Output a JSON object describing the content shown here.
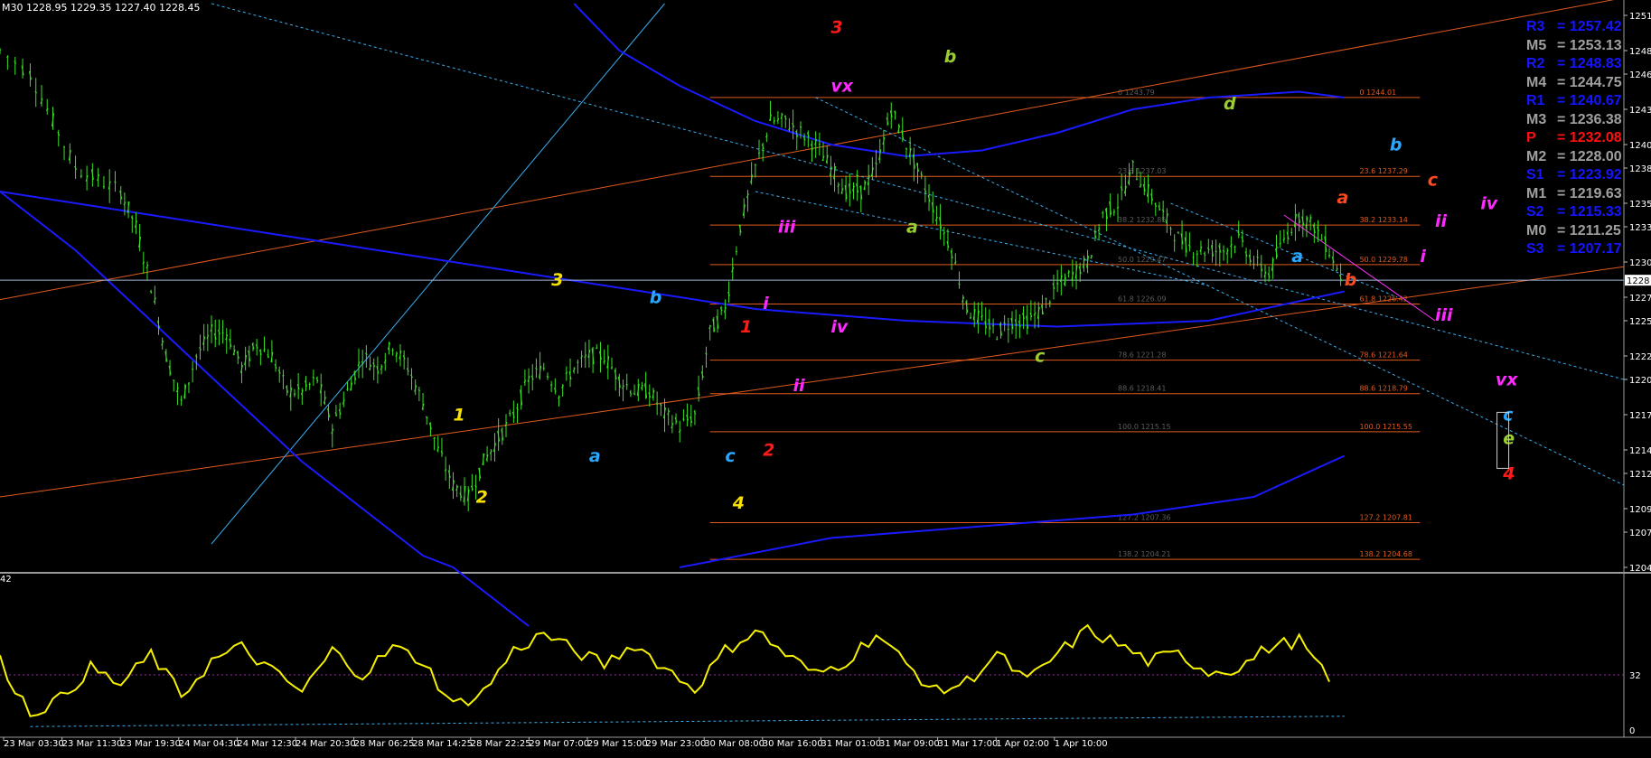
{
  "header": {
    "timeframe": "M30",
    "ohlc": "1228.95 1229.35 1227.40 1228.45"
  },
  "sub_window": {
    "label": "42"
  },
  "pivots": [
    {
      "name": "R3",
      "value": "1257.42",
      "color": "#1515ff"
    },
    {
      "name": "M5",
      "value": "1253.13",
      "color": "#a0a0a0"
    },
    {
      "name": "R2",
      "value": "1248.83",
      "color": "#1515ff"
    },
    {
      "name": "M4",
      "value": "1244.75",
      "color": "#a0a0a0"
    },
    {
      "name": "R1",
      "value": "1240.67",
      "color": "#1515ff"
    },
    {
      "name": "M3",
      "value": "1236.38",
      "color": "#a0a0a0"
    },
    {
      "name": "P",
      "value": "1232.08",
      "color": "#ff1010"
    },
    {
      "name": "M2",
      "value": "1228.00",
      "color": "#a0a0a0"
    },
    {
      "name": "S1",
      "value": "1223.92",
      "color": "#1515ff"
    },
    {
      "name": "M1",
      "value": "1219.63",
      "color": "#a0a0a0"
    },
    {
      "name": "S2",
      "value": "1215.33",
      "color": "#1515ff"
    },
    {
      "name": "M0",
      "value": "1211.25",
      "color": "#a0a0a0"
    },
    {
      "name": "S3",
      "value": "1207.17",
      "color": "#1515ff"
    }
  ],
  "colors": {
    "background": "#000000",
    "candles": "#3ce028",
    "moving_average": "#1a1aff",
    "fib_lines": "#e05a1e",
    "trend_lines": "#e05a1e",
    "channel": "#3aaef0",
    "oscillator": "#f5f000",
    "price_line": "#a0b8d8"
  },
  "chart_data": {
    "type": "line",
    "symbol_timeframe": "M30",
    "current_price": 1228.45,
    "y_range": [
      1204,
      1252
    ],
    "y_ticks": [
      1251,
      1248,
      1246,
      1243,
      1240,
      1238,
      1235,
      1233,
      1230,
      1227,
      1225,
      1222,
      1220,
      1217,
      1214,
      1212,
      1209,
      1207,
      1204
    ],
    "price_marker": "1228",
    "x_tick_labels": [
      "23 Mar 03:30",
      "23 Mar 11:30",
      "23 Mar 19:30",
      "24 Mar 04:30",
      "24 Mar 12:30",
      "24 Mar 20:30",
      "28 Mar 06:25",
      "28 Mar 14:25",
      "28 Mar 22:25",
      "29 Mar 07:00",
      "29 Mar 15:00",
      "29 Mar 23:00",
      "30 Mar 08:00",
      "30 Mar 16:00",
      "31 Mar 01:00",
      "31 Mar 09:00",
      "31 Mar 17:00",
      "1 Apr 02:00",
      "1 Apr 10:00"
    ],
    "price_series": [
      [
        0,
        1248
      ],
      [
        4,
        1246
      ],
      [
        7,
        1242
      ],
      [
        10,
        1238
      ],
      [
        13,
        1237
      ],
      [
        16,
        1236
      ],
      [
        18,
        1233
      ],
      [
        20,
        1228
      ],
      [
        22,
        1222
      ],
      [
        24,
        1218
      ],
      [
        26,
        1222
      ],
      [
        28,
        1224
      ],
      [
        30,
        1224
      ],
      [
        32,
        1221
      ],
      [
        34,
        1223
      ],
      [
        36,
        1222
      ],
      [
        38,
        1219
      ],
      [
        40,
        1219
      ],
      [
        42,
        1220
      ],
      [
        44,
        1216
      ],
      [
        46,
        1219
      ],
      [
        48,
        1222
      ],
      [
        50,
        1221
      ],
      [
        52,
        1223
      ],
      [
        54,
        1221
      ],
      [
        56,
        1218
      ],
      [
        58,
        1214
      ],
      [
        60,
        1211
      ],
      [
        62,
        1210
      ],
      [
        64,
        1213
      ],
      [
        66,
        1215
      ],
      [
        68,
        1217
      ],
      [
        70,
        1220
      ],
      [
        72,
        1221
      ],
      [
        74,
        1219
      ],
      [
        76,
        1221
      ],
      [
        78,
        1222
      ],
      [
        80,
        1222
      ],
      [
        82,
        1220
      ],
      [
        84,
        1219
      ],
      [
        86,
        1219
      ],
      [
        88,
        1217
      ],
      [
        90,
        1216
      ],
      [
        92,
        1217
      ],
      [
        94,
        1224
      ],
      [
        96,
        1226
      ],
      [
        98,
        1233
      ],
      [
        100,
        1238
      ],
      [
        102,
        1242
      ],
      [
        104,
        1242
      ],
      [
        106,
        1241
      ],
      [
        108,
        1240
      ],
      [
        110,
        1238
      ],
      [
        112,
        1236
      ],
      [
        114,
        1236
      ],
      [
        116,
        1238
      ],
      [
        118,
        1243
      ],
      [
        120,
        1240
      ],
      [
        122,
        1237
      ],
      [
        124,
        1234
      ],
      [
        126,
        1231
      ],
      [
        128,
        1226
      ],
      [
        130,
        1225
      ],
      [
        132,
        1224
      ],
      [
        134,
        1225
      ],
      [
        136,
        1225
      ],
      [
        138,
        1226
      ],
      [
        140,
        1228
      ],
      [
        142,
        1229
      ],
      [
        144,
        1230
      ],
      [
        146,
        1234
      ],
      [
        148,
        1235
      ],
      [
        150,
        1238
      ],
      [
        152,
        1236
      ],
      [
        154,
        1234
      ],
      [
        156,
        1232
      ],
      [
        158,
        1231
      ],
      [
        160,
        1231
      ],
      [
        162,
        1231
      ],
      [
        164,
        1232
      ],
      [
        166,
        1230
      ],
      [
        168,
        1229
      ],
      [
        170,
        1232
      ],
      [
        172,
        1234
      ],
      [
        174,
        1233
      ],
      [
        176,
        1231
      ],
      [
        178,
        1228
      ]
    ],
    "oscillator": {
      "y_ticks": [
        32,
        0
      ],
      "dotted_level": 32,
      "values": [
        [
          0,
          40
        ],
        [
          4,
          10
        ],
        [
          8,
          18
        ],
        [
          12,
          36
        ],
        [
          16,
          26
        ],
        [
          20,
          44
        ],
        [
          24,
          20
        ],
        [
          28,
          40
        ],
        [
          32,
          48
        ],
        [
          36,
          34
        ],
        [
          40,
          22
        ],
        [
          44,
          46
        ],
        [
          48,
          32
        ],
        [
          52,
          48
        ],
        [
          56,
          40
        ],
        [
          60,
          14
        ],
        [
          64,
          22
        ],
        [
          68,
          46
        ],
        [
          72,
          56
        ],
        [
          76,
          46
        ],
        [
          80,
          38
        ],
        [
          84,
          50
        ],
        [
          88,
          36
        ],
        [
          92,
          24
        ],
        [
          96,
          46
        ],
        [
          100,
          58
        ],
        [
          104,
          44
        ],
        [
          108,
          32
        ],
        [
          112,
          40
        ],
        [
          116,
          56
        ],
        [
          120,
          38
        ],
        [
          124,
          22
        ],
        [
          128,
          28
        ],
        [
          132,
          44
        ],
        [
          136,
          28
        ],
        [
          140,
          44
        ],
        [
          144,
          58
        ],
        [
          148,
          50
        ],
        [
          152,
          40
        ],
        [
          156,
          44
        ],
        [
          160,
          34
        ],
        [
          164,
          36
        ],
        [
          168,
          48
        ],
        [
          172,
          52
        ],
        [
          176,
          28
        ]
      ]
    },
    "fib_levels": [
      {
        "level": "0",
        "label": "0 1244.01",
        "faint": "0 1243.79",
        "value": 1244.01
      },
      {
        "level": "23.6",
        "label": "23.6 1237.29",
        "faint": "23.6 1237.03",
        "value": 1237.29
      },
      {
        "level": "38.2",
        "label": "38.2 1233.14",
        "faint": "38.2 1232.85",
        "value": 1233.14
      },
      {
        "level": "50.0",
        "label": "50.0 1229.78",
        "faint": "50.0 1229.47",
        "value": 1229.78
      },
      {
        "level": "61.8",
        "label": "61.8 1226.42",
        "faint": "61.8 1226.09",
        "value": 1226.42
      },
      {
        "level": "78.6",
        "label": "78.6 1221.64",
        "faint": "78.6 1221.28",
        "value": 1221.64
      },
      {
        "level": "88.6",
        "label": "88.6 1218.79",
        "faint": "88.6 1218.41",
        "value": 1218.79
      },
      {
        "level": "100.0",
        "label": "100.0 1215.55",
        "faint": "100.0 1215.15",
        "value": 1215.55
      },
      {
        "level": "127.2",
        "label": "127.2 1207.81",
        "faint": "127.2 1207.36",
        "value": 1207.81
      },
      {
        "level": "138.2",
        "label": "138.2 1204.68",
        "faint": "138.2 1204.21",
        "value": 1204.68
      }
    ],
    "wave_labels": [
      {
        "text": "3",
        "color": "#ff1a1a",
        "x": 110,
        "y": 1249.5
      },
      {
        "text": "b",
        "color": "#9acd32",
        "x": 125,
        "y": 1247
      },
      {
        "text": "vx",
        "color": "#ff2aff",
        "x": 110,
        "y": 1244.5
      },
      {
        "text": "d",
        "color": "#9acd32",
        "x": 162,
        "y": 1243
      },
      {
        "text": "b",
        "color": "#2aa8ff",
        "x": 184,
        "y": 1239.5
      },
      {
        "text": "c",
        "color": "#ff4a20",
        "x": 189,
        "y": 1236.5
      },
      {
        "text": "a",
        "color": "#ff4a20",
        "x": 177,
        "y": 1235
      },
      {
        "text": "iv",
        "color": "#ff2aff",
        "x": 196,
        "y": 1234.5
      },
      {
        "text": "ii",
        "color": "#ff2aff",
        "x": 190,
        "y": 1233
      },
      {
        "text": "iii",
        "color": "#ff2aff",
        "x": 103,
        "y": 1232.5
      },
      {
        "text": "a",
        "color": "#9acd32",
        "x": 120,
        "y": 1232.5
      },
      {
        "text": "a",
        "color": "#2aa8ff",
        "x": 171,
        "y": 1230
      },
      {
        "text": "i",
        "color": "#ff2aff",
        "x": 188,
        "y": 1230
      },
      {
        "text": "3",
        "color": "#f5e000",
        "x": 73,
        "y": 1228
      },
      {
        "text": "b",
        "color": "#2aa8ff",
        "x": 86,
        "y": 1226.5
      },
      {
        "text": "b",
        "color": "#ff4a20",
        "x": 178,
        "y": 1228
      },
      {
        "text": "iii",
        "color": "#ff2aff",
        "x": 190,
        "y": 1225
      },
      {
        "text": "1",
        "color": "#ff1a1a",
        "x": 98,
        "y": 1224
      },
      {
        "text": "i",
        "color": "#ff2aff",
        "x": 101,
        "y": 1226
      },
      {
        "text": "iv",
        "color": "#ff2aff",
        "x": 110,
        "y": 1224
      },
      {
        "text": "c",
        "color": "#9acd32",
        "x": 137,
        "y": 1221.5
      },
      {
        "text": "vx",
        "color": "#ff2aff",
        "x": 198,
        "y": 1219.5
      },
      {
        "text": "ii",
        "color": "#ff2aff",
        "x": 105,
        "y": 1219
      },
      {
        "text": "1",
        "color": "#f5e000",
        "x": 60,
        "y": 1216.5
      },
      {
        "text": "c",
        "color": "#2aa8ff",
        "x": 199,
        "y": 1216.5
      },
      {
        "text": "e",
        "color": "#9acd32",
        "x": 199,
        "y": 1214.5
      },
      {
        "text": "a",
        "color": "#2aa8ff",
        "x": 78,
        "y": 1213
      },
      {
        "text": "c",
        "color": "#2aa8ff",
        "x": 96,
        "y": 1213
      },
      {
        "text": "2",
        "color": "#ff1a1a",
        "x": 101,
        "y": 1213.5
      },
      {
        "text": "4",
        "color": "#ff1a1a",
        "x": 199,
        "y": 1211.5
      },
      {
        "text": "2",
        "color": "#f5e000",
        "x": 63,
        "y": 1209.5
      },
      {
        "text": "4",
        "color": "#f5e000",
        "x": 97,
        "y": 1209
      }
    ]
  }
}
